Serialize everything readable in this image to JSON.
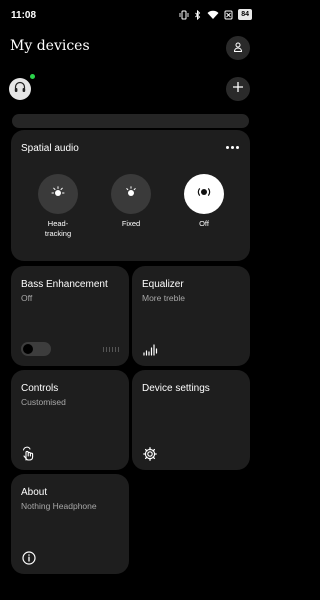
{
  "status_bar": {
    "time": "11:08",
    "battery": "84",
    "icons": [
      "vibrate-icon",
      "bluetooth-icon",
      "wifi-icon",
      "signal-icon",
      "battery-icon"
    ]
  },
  "header": {
    "title": "My devices",
    "profile_icon": "person-icon"
  },
  "devices": {
    "connected_status_color": "#2bd34b",
    "add_icon": "plus-icon"
  },
  "spatial_audio": {
    "title": "Spatial audio",
    "modes": [
      {
        "label": "Head-\ntracking",
        "icon": "head-tracking-icon",
        "selected": false
      },
      {
        "label": "Fixed",
        "icon": "fixed-icon",
        "selected": false
      },
      {
        "label": "Off",
        "icon": "off-icon",
        "selected": true
      }
    ]
  },
  "bass": {
    "title": "Bass Enhancement",
    "value": "Off",
    "enabled": false
  },
  "equalizer": {
    "title": "Equalizer",
    "value": "More treble"
  },
  "controls": {
    "title": "Controls",
    "value": "Customised"
  },
  "device_settings": {
    "title": "Device settings"
  },
  "about": {
    "title": "About",
    "value": "Nothing Headphone"
  },
  "colors": {
    "background": "#000000",
    "card": "#1e1e1e",
    "text_secondary": "#a8a8a8",
    "selected_mode": "#ffffff"
  }
}
